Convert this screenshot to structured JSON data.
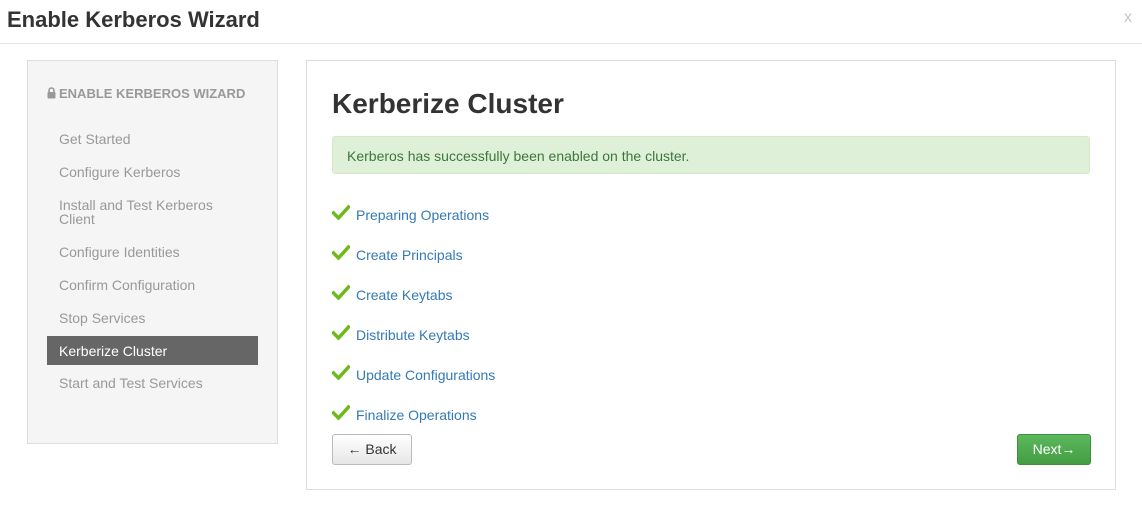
{
  "window": {
    "title": "Enable Kerberos Wizard",
    "close_label": "x"
  },
  "sidebar": {
    "heading": "ENABLE KERBEROS WIZARD",
    "items": [
      {
        "label": "Get Started"
      },
      {
        "label": "Configure Kerberos"
      },
      {
        "label": "Install and Test Kerberos Client"
      },
      {
        "label": "Configure Identities"
      },
      {
        "label": "Confirm Configuration"
      },
      {
        "label": "Stop Services"
      },
      {
        "label": "Kerberize Cluster",
        "active": true
      },
      {
        "label": "Start and Test Services"
      }
    ]
  },
  "main": {
    "title": "Kerberize Cluster",
    "alert": "Kerberos has successfully been enabled on the cluster.",
    "tasks": [
      {
        "label": "Preparing Operations",
        "icon": "check-icon",
        "status": "complete"
      },
      {
        "label": "Create Principals",
        "icon": "check-icon",
        "status": "complete"
      },
      {
        "label": "Create Keytabs",
        "icon": "check-icon",
        "status": "complete"
      },
      {
        "label": "Distribute Keytabs",
        "icon": "check-icon",
        "status": "complete"
      },
      {
        "label": "Update Configurations",
        "icon": "check-icon",
        "status": "complete"
      },
      {
        "label": "Finalize Operations",
        "icon": "check-icon",
        "status": "complete"
      }
    ]
  },
  "buttons": {
    "back_label": "← Back",
    "next_label": "Next→"
  },
  "colors": {
    "success_green": "#5cb85c",
    "check_green": "#6cba1c",
    "link_blue": "#337ab7",
    "active_item_bg": "#666666",
    "alert_bg": "#dff0d8"
  }
}
